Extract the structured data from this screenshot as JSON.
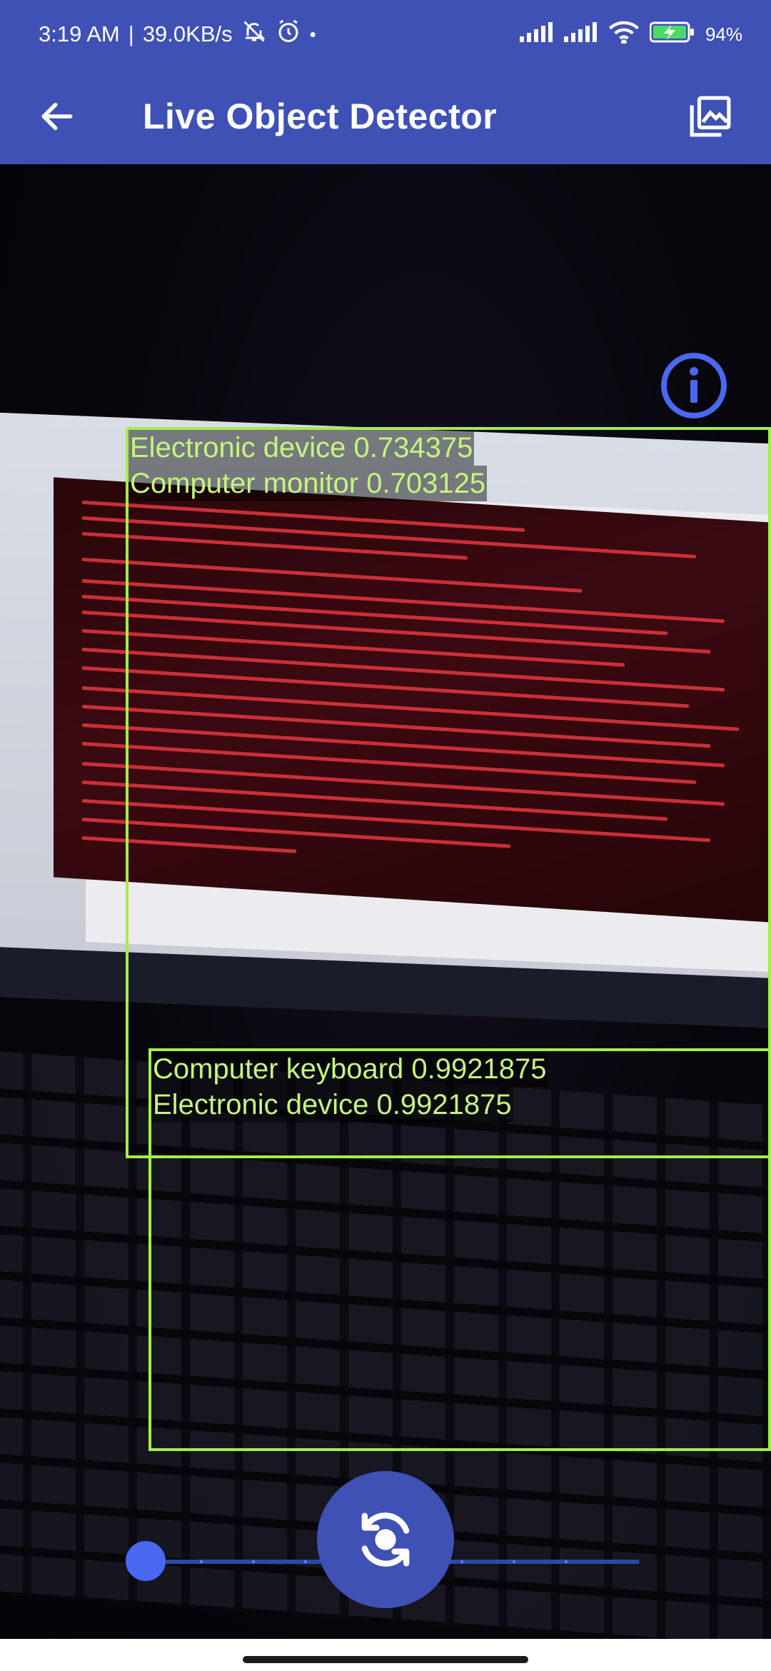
{
  "status_bar": {
    "time": "3:19 AM",
    "network_speed": "39.0KB/s",
    "separator": "|",
    "battery_percent": "94%",
    "icons": [
      "mute-icon",
      "alarm-icon",
      "dot-icon",
      "signal-icon",
      "signal-icon",
      "wifi-icon",
      "battery-charging-icon"
    ]
  },
  "app_bar": {
    "title": "Live Object Detector",
    "back_icon": "arrow-back-icon",
    "gallery_icon": "gallery-icon",
    "background_color": "#3f51b5"
  },
  "detections": [
    {
      "labels": [
        "Electronic device 0.734375",
        "Computer monitor 0.703125"
      ]
    },
    {
      "labels": [
        "Computer keyboard 0.9921875",
        "Electronic device 0.9921875"
      ]
    }
  ],
  "box_color": "#a4ee4c",
  "controls": {
    "info_icon": "info-icon",
    "switch_camera_icon": "switch-camera-icon",
    "zoom_level": 0
  }
}
